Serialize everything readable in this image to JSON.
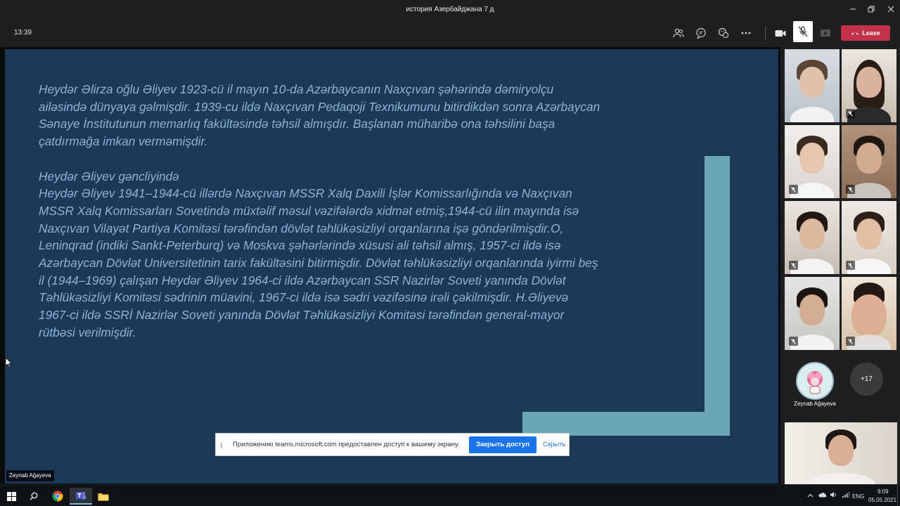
{
  "window": {
    "title": "история Азербайджана 7 д"
  },
  "toolbar": {
    "time": "13:39",
    "leave_label": "Leave"
  },
  "slide": {
    "paragraphs": [
      "Heydər Əlirza oğlu Əliyev 1923-cü il mayın 10-da Azərbaycanın Naxçıvan şəhərində dəmiryolçu ailəsində dünyaya gəlmişdir. 1939-cu ildə Naxçıvan Pedaqoji Texnikumunu bitirdikdən sonra Azərbaycan Sənaye İnstitutunun memarlıq fakültəsində təhsil almışdır. Başlanan müharibə ona təhsilini başa çatdırmağa imkan verməmişdir.",
      "Heydər Əliyev gəncliyində",
      "Heydər Əliyev 1941–1944-cü illərdə Naxçıvan MSSR Xalq Daxili İşlər Komissarlığında və Naxçıvan MSSR Xalq Komissarları Sovetində müxtəlif məsul vəzifələrdə xidmət etmiş,1944-cü ilin mayında isə Naxçıvan Vilayət Partiya Komitəsi tərəfindən dövlət təhlükəsizliyi orqanlarına işə göndərilmişdir.O, Leninqrad (indiki Sankt-Peterburq) və Moskva şəhərlərində xüsusi ali təhsil almış, 1957-ci ildə isə Azərbaycan Dövlət Universitetinin tarix fakültəsini bitirmişdir. Dövlət təhlükəsizliyi orqanlarında iyirmi beş il (1944–1969) çalışan Heydər Əliyev 1964-ci ildə Azərbaycan SSR Nazirlər Soveti yanında Dövlət Təhlükəsizliyi Komitəsi sədrinin müavini, 1967-ci ildə isə sədri vəzifəsinə irəli çəkilmişdir. H.Əliyevə 1967-ci ildə SSRİ Nazirlər Soveti yanında Dövlət Təhlükəsizliyi Komitəsi tərəfindən general-mayor rütbəsi verilmişdir."
    ]
  },
  "share_banner": {
    "message": "Приложению teams.microsoft.com предоставлен доступ к вашему экрану.",
    "stop_label": "Закрыть доступ",
    "hide_label": "Скрыть"
  },
  "presenter_name": "Zeynab Ağayeva",
  "participants": {
    "avatar_name": "Zeynab Ağayeva",
    "more_count": "+17"
  },
  "taskbar": {
    "language": "ENG",
    "time": "9:09",
    "date": "05.05.2021"
  },
  "colors": {
    "leave": "#c4314b",
    "slide_bg": "#1c3a57",
    "slide_text": "#8fb2d9",
    "accent": "#6aa6b4",
    "share_button": "#1a73e8"
  }
}
